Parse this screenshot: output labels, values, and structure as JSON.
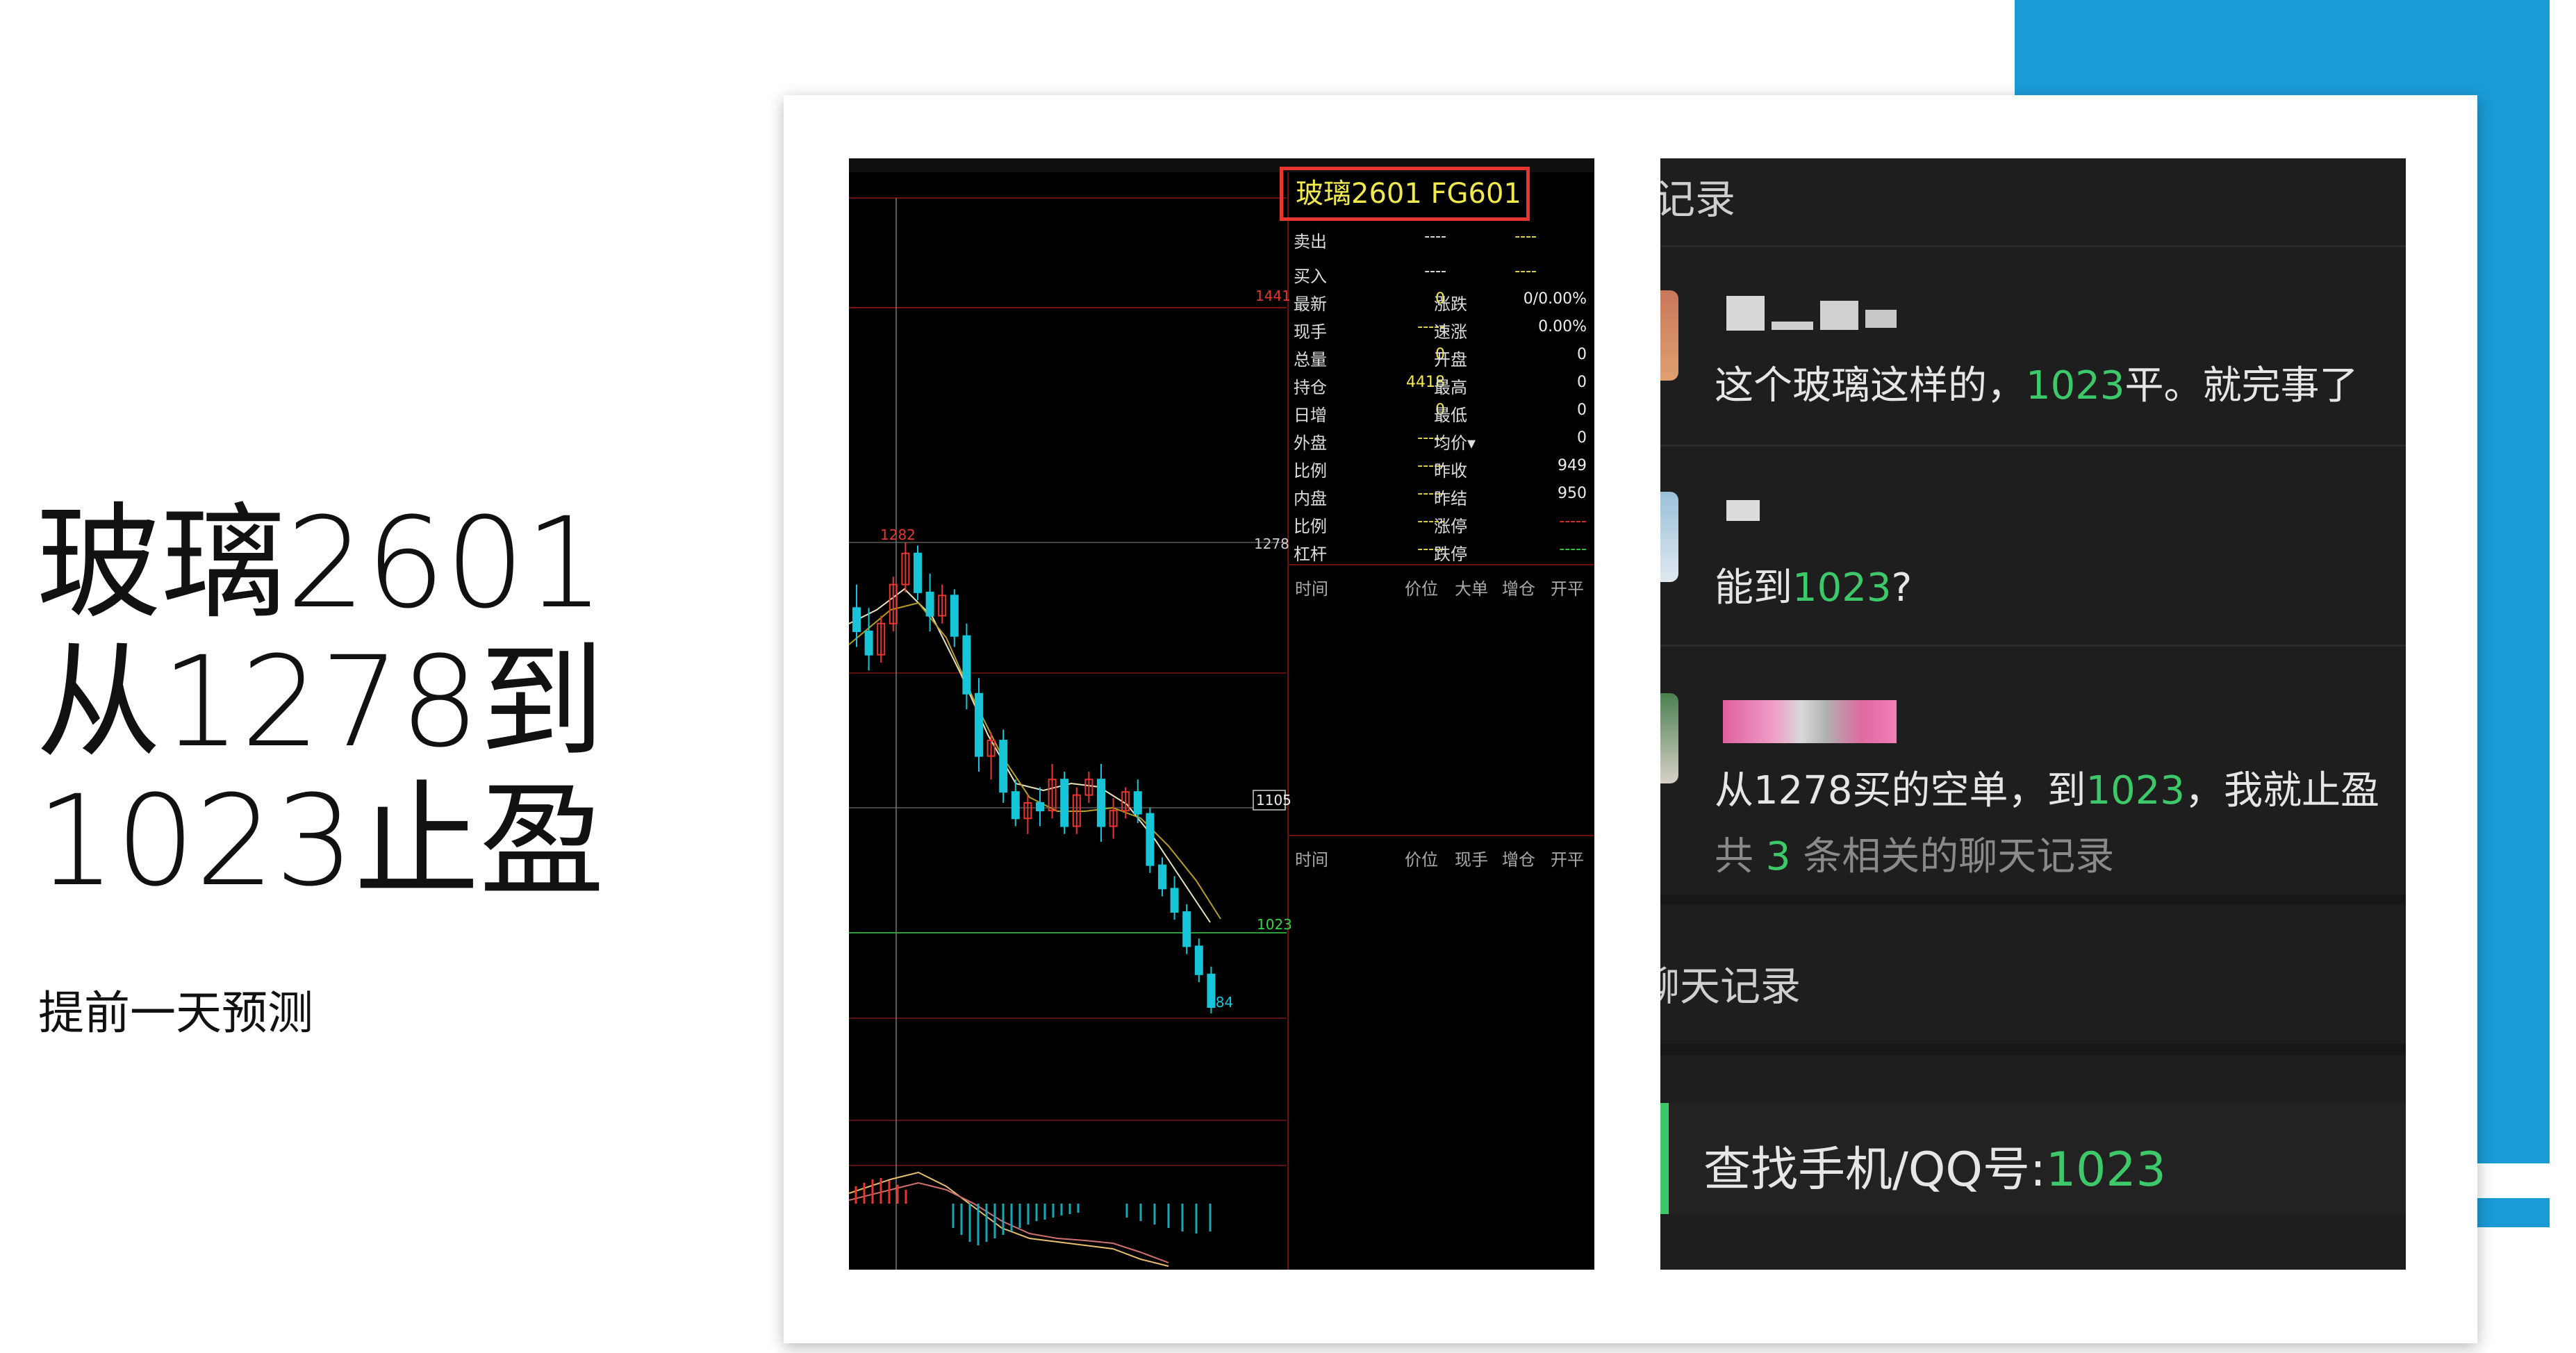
{
  "headline": {
    "lines": [
      "玻璃2601",
      "从1278到",
      "1023止盈"
    ],
    "sub": "提前一天预测"
  },
  "colors": {
    "accent_blue": "#1a9bd7",
    "up": "#e8362f",
    "down": "#16c6d8",
    "highlight_green": "#3dc86a"
  },
  "trading": {
    "symbol_title": "玻璃2601  FG601",
    "sell_label": "卖出",
    "buy_label": "买入",
    "sell_val": "----",
    "buy_val": "----",
    "rows": [
      {
        "l1": "最新",
        "v1": "0",
        "l2": "涨跌",
        "v2": "0/0.00%"
      },
      {
        "l1": "现手",
        "v1": "-----",
        "l2": "速涨",
        "v2": "0.00%"
      },
      {
        "l1": "总量",
        "v1": "0",
        "l2": "开盘",
        "v2": "0"
      },
      {
        "l1": "持仓",
        "v1": "4418",
        "l2": "最高",
        "v2": "0"
      },
      {
        "l1": "日增",
        "v1": "0",
        "l2": "最低",
        "v2": "0"
      },
      {
        "l1": "外盘",
        "v1": "-----",
        "l2": "均价▾",
        "v2": "0"
      },
      {
        "l1": "比例",
        "v1": "-----",
        "l2": "昨收",
        "v2": "949"
      },
      {
        "l1": "内盘",
        "v1": "-----",
        "l2": "昨结",
        "v2": "950"
      },
      {
        "l1": "比例",
        "v1": "-----",
        "l2": "涨停",
        "v2": "-----"
      },
      {
        "l1": "杠杆",
        "v1": "-----",
        "l2": "跌停",
        "v2": "-----"
      }
    ],
    "tick_headers_1": [
      "时间",
      "价位",
      "大单",
      "增仓",
      "开平"
    ],
    "tick_headers_2": [
      "时间",
      "价位",
      "现手",
      "增仓",
      "开平"
    ],
    "price_labels": {
      "p1441": "1441",
      "p1282": "1282",
      "p1278": "1278",
      "p1105": "1105",
      "p1023": "1023",
      "p984": "984"
    }
  },
  "chart_data": {
    "type": "candlestick",
    "price_levels": [
      1441,
      1282,
      1278,
      1105,
      1023,
      984
    ],
    "annotations": [
      "1282",
      "1278",
      "1105",
      "1023",
      "984"
    ],
    "candles_ohlc": [
      [
        1240,
        1255,
        1215,
        1225
      ],
      [
        1225,
        1240,
        1200,
        1210
      ],
      [
        1210,
        1235,
        1205,
        1230
      ],
      [
        1230,
        1260,
        1225,
        1255
      ],
      [
        1255,
        1282,
        1250,
        1275
      ],
      [
        1275,
        1280,
        1245,
        1250
      ],
      [
        1250,
        1262,
        1225,
        1235
      ],
      [
        1235,
        1255,
        1230,
        1248
      ],
      [
        1248,
        1252,
        1215,
        1222
      ],
      [
        1222,
        1230,
        1175,
        1185
      ],
      [
        1185,
        1195,
        1135,
        1145
      ],
      [
        1145,
        1160,
        1130,
        1155
      ],
      [
        1155,
        1162,
        1115,
        1122
      ],
      [
        1122,
        1130,
        1100,
        1105
      ],
      [
        1105,
        1120,
        1095,
        1115
      ],
      [
        1115,
        1125,
        1100,
        1110
      ],
      [
        1110,
        1140,
        1105,
        1130
      ],
      [
        1130,
        1135,
        1095,
        1100
      ],
      [
        1100,
        1125,
        1095,
        1120
      ],
      [
        1120,
        1135,
        1115,
        1130
      ],
      [
        1130,
        1140,
        1090,
        1100
      ],
      [
        1100,
        1118,
        1092,
        1110
      ],
      [
        1110,
        1125,
        1105,
        1122
      ],
      [
        1122,
        1130,
        1102,
        1108
      ],
      [
        1108,
        1112,
        1070,
        1075
      ],
      [
        1075,
        1080,
        1055,
        1060
      ],
      [
        1060,
        1068,
        1040,
        1045
      ],
      [
        1045,
        1050,
        1018,
        1023
      ],
      [
        1023,
        1028,
        1000,
        1005
      ],
      [
        1005,
        1010,
        980,
        984
      ]
    ]
  },
  "chat": {
    "header_partial": "记录",
    "m1_a": "这个玻璃这样的，",
    "m1_b": "1023",
    "m1_c": "平。就完事了",
    "m2_a": "能到",
    "m2_b": "1023",
    "m2_c": "?",
    "m3_a": "从1278买的空单，到",
    "m3_b": "1023",
    "m3_c": "，我就止盈",
    "m3_more_a": "共 ",
    "m3_more_b": "3",
    "m3_more_c": " 条相关的聊天记录",
    "section_partial": "聊天记录",
    "search_a": "查找手机/QQ号:",
    "search_b": "1023"
  }
}
